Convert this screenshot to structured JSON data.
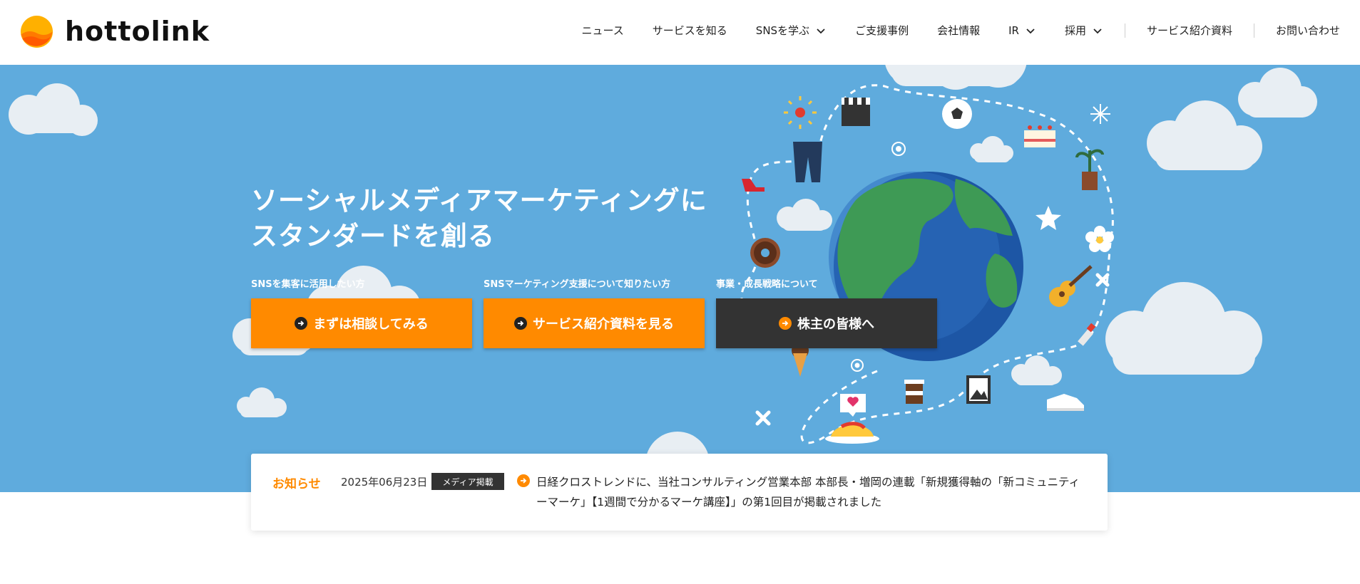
{
  "header": {
    "logo_text": "hottolink",
    "nav": [
      {
        "label": "ニュース",
        "dropdown": false
      },
      {
        "label": "サービスを知る",
        "dropdown": false
      },
      {
        "label": "SNSを学ぶ",
        "dropdown": true
      },
      {
        "label": "ご支援事例",
        "dropdown": false
      },
      {
        "label": "会社情報",
        "dropdown": false
      },
      {
        "label": "IR",
        "dropdown": true
      },
      {
        "label": "採用",
        "dropdown": true
      },
      {
        "label": "サービス紹介資料",
        "dropdown": false
      },
      {
        "label": "お問い合わせ",
        "dropdown": false
      }
    ]
  },
  "hero": {
    "tagline_line1": "ソーシャルメディアマーケティングに",
    "tagline_line2": "スタンダードを創る",
    "ctas": [
      {
        "caption": "SNSを集客に活用したい方",
        "label": "まずは相談してみる",
        "style": "orange"
      },
      {
        "caption": "SNSマーケティング支援について知りたい方",
        "label": "サービス紹介資料を見る",
        "style": "orange"
      },
      {
        "caption": "事業・成長戦略について",
        "label": "株主の皆様へ",
        "style": "dark"
      }
    ]
  },
  "news": {
    "label": "お知らせ",
    "date": "2025年06月23日",
    "badge": "メディア掲載",
    "text": "日経クロストレンドに、当社コンサルティング営業本部 本部長・増岡の連載「新規獲得軸の「新コミュニティーマーケ」【1週間で分かるマーケ講座】」の第1回目が掲載されました"
  },
  "colors": {
    "brand_orange": "#ff8a00",
    "hero_sky": "#5fabdd",
    "dark_button": "#333333",
    "globe_ocean": "#1d56a5",
    "globe_land": "#3e9a55"
  },
  "icons": [
    "logo-mark-icon",
    "chevron-down-icon",
    "arrow-right-circle-icon",
    "globe-illustration",
    "cloud-illustration"
  ]
}
